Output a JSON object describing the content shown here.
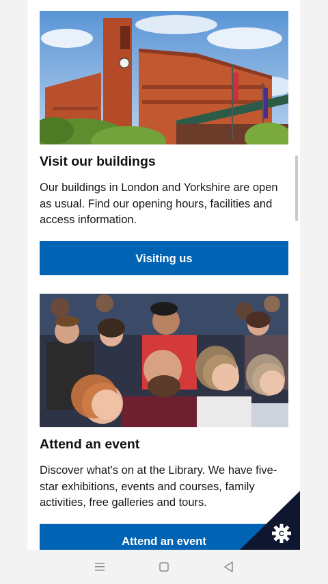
{
  "cards": [
    {
      "title": "Visit our buildings",
      "text": "Our buildings in London and Yorkshire are open as usual. Find our opening hours, facilities and access information.",
      "button_label": "Visiting us",
      "image_alt": "British Library building with clock tower"
    },
    {
      "title": "Attend an event",
      "text": "Discover what's on at the Library. We have five-star exhibitions, events and courses, family activities, free galleries and tours.",
      "button_label": "Attend an event",
      "image_alt": "Audience watching an event"
    }
  ],
  "cookie_badge": {
    "icon": "cookie-settings-icon",
    "color": "#0f1630"
  },
  "system_nav": {
    "menu_icon": "menu-icon",
    "home_icon": "home-icon",
    "back_icon": "back-icon"
  },
  "colors": {
    "button": "#0063b3",
    "background": "#ffffff",
    "page_bg": "#f3f3f3"
  }
}
